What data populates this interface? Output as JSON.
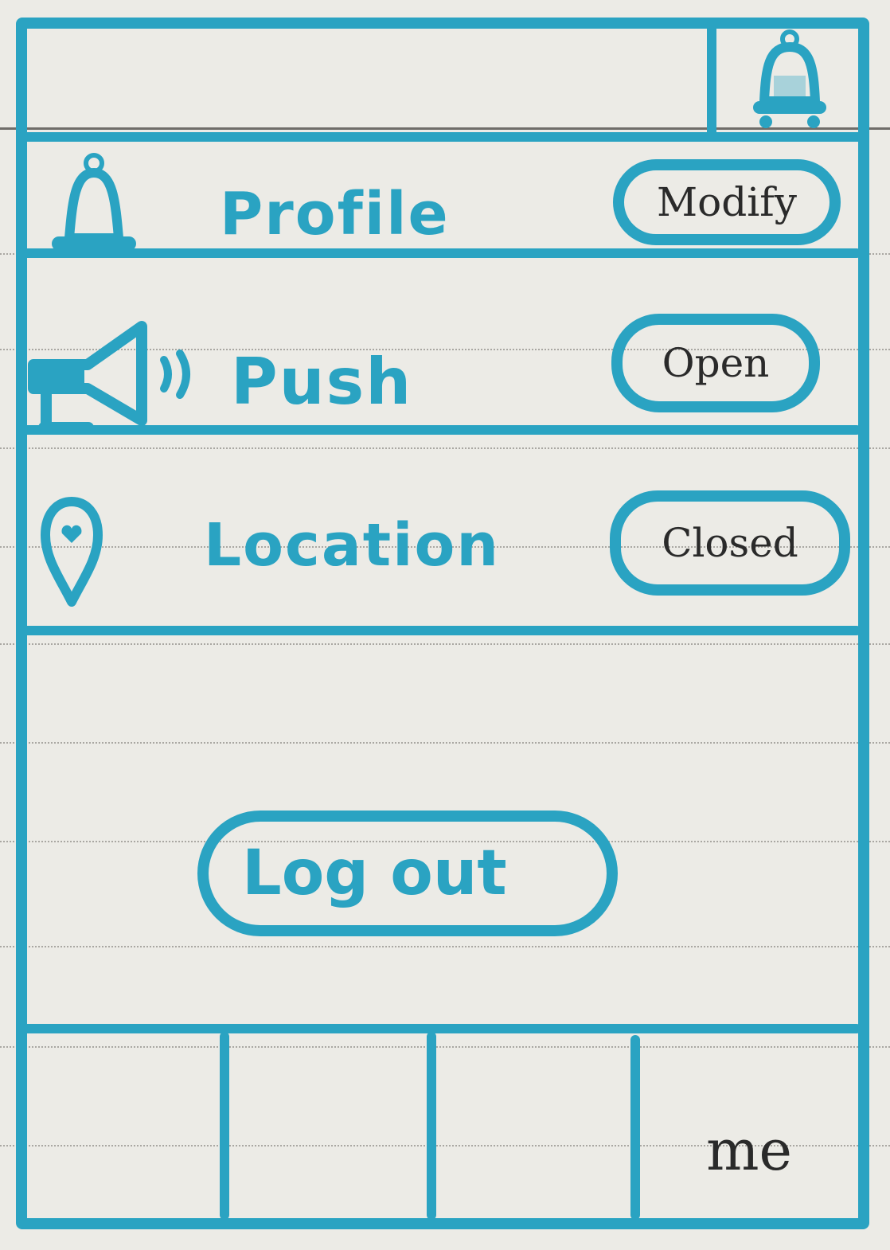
{
  "header": {
    "icon": "bell-icon"
  },
  "settings": {
    "rows": [
      {
        "icon": "bell-icon",
        "label": "Profile",
        "action_label": "Modify"
      },
      {
        "icon": "megaphone-icon",
        "label": "Push",
        "action_label": "Open"
      },
      {
        "icon": "location-pin-icon",
        "label": "Location",
        "action_label": "Closed"
      }
    ]
  },
  "logout": {
    "label": "Log out"
  },
  "tabbar": {
    "tabs": [
      {
        "label": ""
      },
      {
        "label": ""
      },
      {
        "label": ""
      },
      {
        "label": "me"
      }
    ]
  },
  "colors": {
    "accent": "#2aa3c2",
    "ink": "#2a2a2a",
    "paper": "#ecebe6"
  }
}
